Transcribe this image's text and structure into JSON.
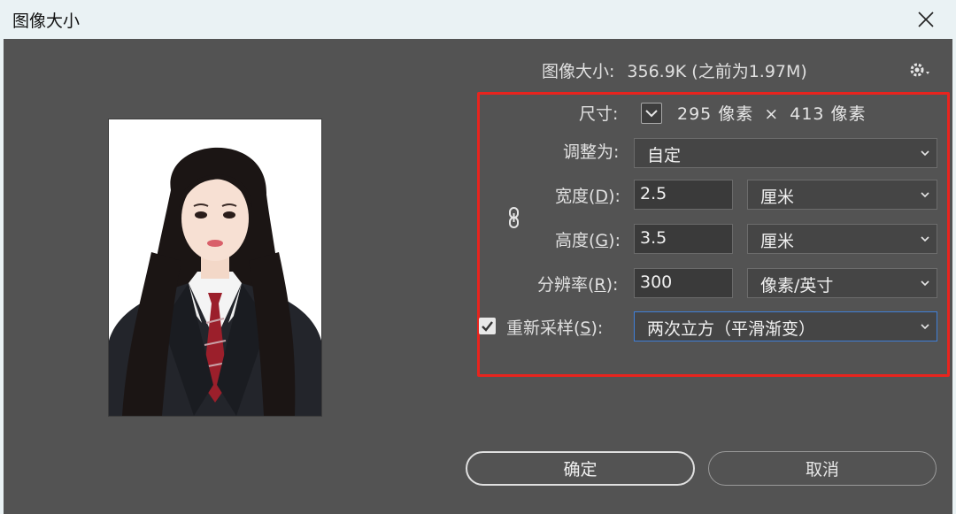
{
  "window": {
    "title": "图像大小",
    "close_icon": "close-icon"
  },
  "image_size": {
    "label": "图像大小:",
    "value": "356.9K (之前为1.97M)"
  },
  "settings_icon": "gear-icon",
  "dimensions": {
    "label": "尺寸:",
    "width": "295 像素",
    "separator": "×",
    "height": "413 像素"
  },
  "fit_to": {
    "label": "调整为:",
    "value": "自定"
  },
  "width": {
    "label_pre": "宽度(",
    "mnemonic": "D",
    "label_post": "):",
    "value": "2.5",
    "unit": "厘米"
  },
  "height": {
    "label_pre": "高度(",
    "mnemonic": "G",
    "label_post": "):",
    "value": "3.5",
    "unit": "厘米"
  },
  "resolution": {
    "label_pre": "分辨率(",
    "mnemonic": "R",
    "label_post": "):",
    "value": "300",
    "unit": "像素/英寸"
  },
  "resample": {
    "label_pre": "重新采样(",
    "mnemonic": "S",
    "label_post": "):",
    "value": "两次立方（平滑渐变）",
    "checked": true
  },
  "buttons": {
    "ok": "确定",
    "cancel": "取消"
  },
  "colors": {
    "highlight": "#e8241e",
    "background": "#535353",
    "titlebar": "#eaf2f4",
    "focus": "#3f7fd8"
  }
}
